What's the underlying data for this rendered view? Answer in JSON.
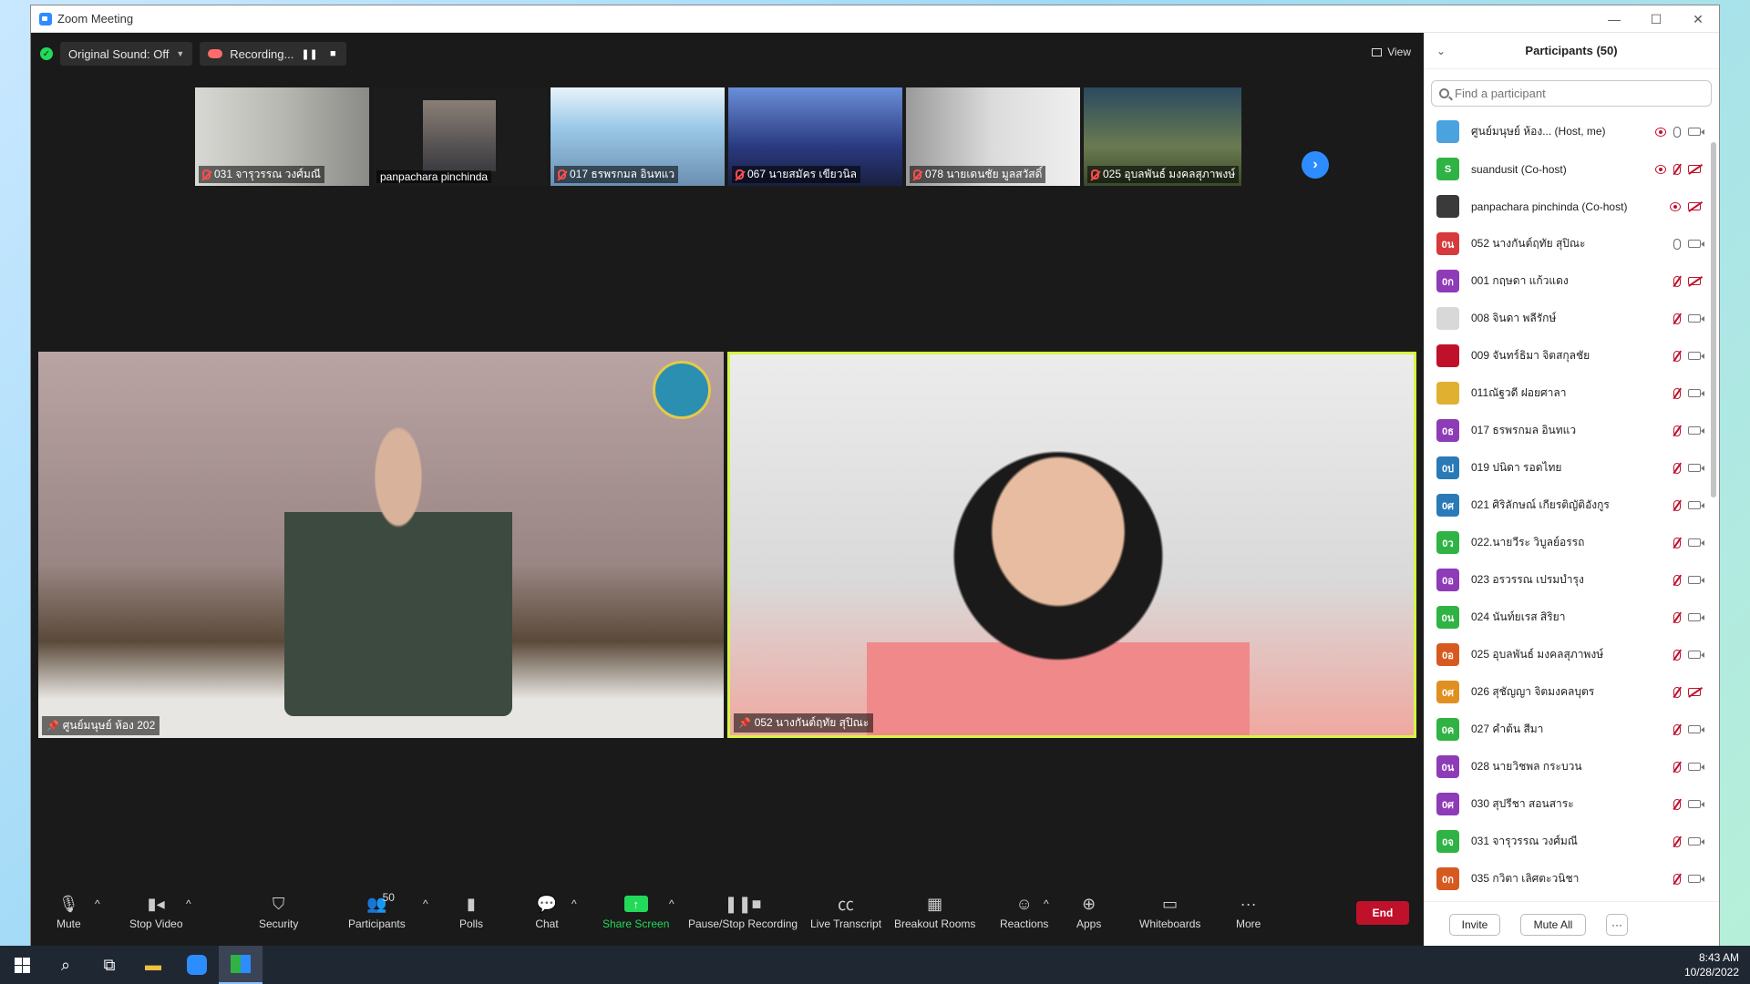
{
  "window": {
    "title": "Zoom Meeting"
  },
  "topbar": {
    "original_sound": "Original Sound: Off",
    "recording": "Recording...",
    "view": "View"
  },
  "thumbnails": [
    {
      "label": "031 จารุวรรณ  วงศ์มณี",
      "muted": true
    },
    {
      "label": "panpachara pinchinda",
      "muted": false
    },
    {
      "label": "017 ธรพรกมล อินทแว",
      "muted": true
    },
    {
      "label": "067 นายสมัคร  เขียวนิล",
      "muted": true
    },
    {
      "label": "078 นายเดนชัย  มูลสวัสดิ์",
      "muted": true
    },
    {
      "label": "025 อุบลพันธ์ มงคลสุภาพงษ์",
      "muted": true
    }
  ],
  "main_videos": [
    {
      "label": "ศูนย์มนุษย์ ห้อง 202"
    },
    {
      "label": "052 นางกันต์ฤทัย  สุปิณะ"
    }
  ],
  "toolbar": {
    "mute": "Mute",
    "stop_video": "Stop Video",
    "security": "Security",
    "participants": "Participants",
    "participants_count": "50",
    "polls": "Polls",
    "chat": "Chat",
    "share_screen": "Share Screen",
    "pause_stop_recording": "Pause/Stop Recording",
    "live_transcript": "Live Transcript",
    "breakout_rooms": "Breakout Rooms",
    "reactions": "Reactions",
    "apps": "Apps",
    "whiteboards": "Whiteboards",
    "more": "More",
    "end": "End"
  },
  "panel": {
    "title": "Participants (50)",
    "search_placeholder": "Find a participant",
    "invite": "Invite",
    "mute_all": "Mute All",
    "more": "···",
    "participants": [
      {
        "avatar": "",
        "avatar_color": "#4aa3df",
        "name": "ศูนย์มนุษย์ ห้อง... (Host, me)",
        "recording": true,
        "mic": "on",
        "cam": "on"
      },
      {
        "avatar": "S",
        "avatar_color": "#2fb344",
        "name": "suandusit (Co-host)",
        "recording": true,
        "mic": "off",
        "cam": "off"
      },
      {
        "avatar": "",
        "avatar_color": "#3a3a3a",
        "name": "panpachara pinchinda (Co-host)",
        "recording": true,
        "mic": "none",
        "cam": "off"
      },
      {
        "avatar": "0น",
        "avatar_color": "#d63a3a",
        "name": "052 นางกันต์ฤทัย  สุปิณะ",
        "recording": false,
        "mic": "on",
        "cam": "on"
      },
      {
        "avatar": "0ก",
        "avatar_color": "#8e3bb8",
        "name": "001 กฤษดา  แก้วแดง",
        "recording": false,
        "mic": "off",
        "cam": "off"
      },
      {
        "avatar": "",
        "avatar_color": "#d8d8d8",
        "name": "008 จินดา  พลีรักษ์",
        "recording": false,
        "mic": "off",
        "cam": "on"
      },
      {
        "avatar": "",
        "avatar_color": "#c0112b",
        "name": "009 จันทร์ธิมา  จิตสกุลชัย",
        "recording": false,
        "mic": "off",
        "cam": "on"
      },
      {
        "avatar": "",
        "avatar_color": "#e0b030",
        "name": "011ณัฐวดี ฝอยศาลา",
        "recording": false,
        "mic": "off",
        "cam": "on"
      },
      {
        "avatar": "0ธ",
        "avatar_color": "#8e3bb8",
        "name": "017 ธรพรกมล อินทแว",
        "recording": false,
        "mic": "off",
        "cam": "on"
      },
      {
        "avatar": "0ป",
        "avatar_color": "#2a7ab8",
        "name": "019 ปนิดา รอดไทย",
        "recording": false,
        "mic": "off",
        "cam": "on"
      },
      {
        "avatar": "0ศ",
        "avatar_color": "#2a7ab8",
        "name": "021 ศิริลักษณ์ เกียรติญัติอังกูร",
        "recording": false,
        "mic": "off",
        "cam": "on"
      },
      {
        "avatar": "0ว",
        "avatar_color": "#2fb344",
        "name": "022.นายวีระ  วิบูลย์อรรถ",
        "recording": false,
        "mic": "off",
        "cam": "on"
      },
      {
        "avatar": "0อ",
        "avatar_color": "#8e3bb8",
        "name": "023 อรวรรณ  เปรมบำรุง",
        "recording": false,
        "mic": "off",
        "cam": "on"
      },
      {
        "avatar": "0น",
        "avatar_color": "#2fb344",
        "name": "024 นันท์ยเรส  สิริยา",
        "recording": false,
        "mic": "off",
        "cam": "on"
      },
      {
        "avatar": "0อ",
        "avatar_color": "#d65a20",
        "name": "025 อุบลพันธ์ มงคลสุภาพงษ์",
        "recording": false,
        "mic": "off",
        "cam": "on"
      },
      {
        "avatar": "0ศ",
        "avatar_color": "#e09020",
        "name": "026 สุชัญญา จิตมงคลบุตร",
        "recording": false,
        "mic": "off",
        "cam": "off"
      },
      {
        "avatar": "0ค",
        "avatar_color": "#2fb344",
        "name": "027 คำต้น สีมา",
        "recording": false,
        "mic": "off",
        "cam": "on"
      },
      {
        "avatar": "0น",
        "avatar_color": "#8e3bb8",
        "name": "028 นายวิชพล  กระบวน",
        "recording": false,
        "mic": "off",
        "cam": "on"
      },
      {
        "avatar": "0ศ",
        "avatar_color": "#8e3bb8",
        "name": "030 สุปรีชา สอนสาระ",
        "recording": false,
        "mic": "off",
        "cam": "on"
      },
      {
        "avatar": "0จ",
        "avatar_color": "#2fb344",
        "name": "031 จารุวรรณ  วงศ์มณี",
        "recording": false,
        "mic": "off",
        "cam": "on"
      },
      {
        "avatar": "0ก",
        "avatar_color": "#d65a20",
        "name": "035 กวิตา เลิศตะวนิชา",
        "recording": false,
        "mic": "off",
        "cam": "on"
      }
    ]
  },
  "taskbar": {
    "time": "8:43 AM",
    "date": "10/28/2022"
  }
}
